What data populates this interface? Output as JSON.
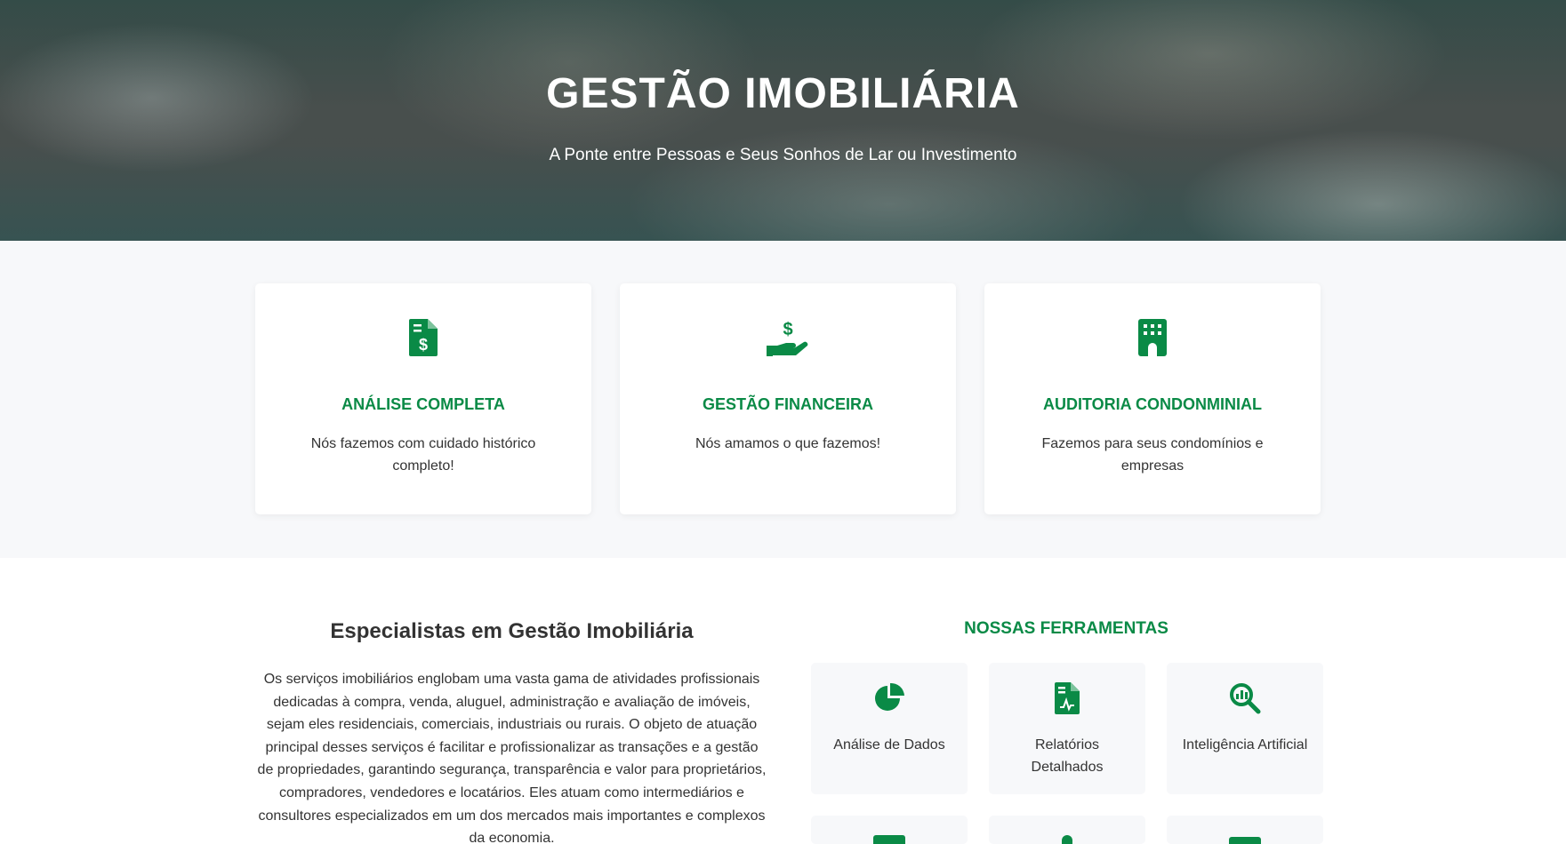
{
  "hero": {
    "title": "GESTÃO IMOBILIÁRIA",
    "subtitle": "A Ponte entre Pessoas e Seus Sonhos de Lar ou Investimento"
  },
  "features": [
    {
      "icon": "invoice-dollar-icon",
      "title": "ANÁLISE COMPLETA",
      "description": "Nós fazemos com cuidado histórico completo!"
    },
    {
      "icon": "hand-holding-dollar-icon",
      "title": "GESTÃO FINANCEIRA",
      "description": "Nós amamos o que fazemos!"
    },
    {
      "icon": "building-icon",
      "title": "AUDITORIA CONDONMINIAL",
      "description": "Fazemos para seus condomínios e empresas"
    }
  ],
  "about": {
    "title": "Especialistas em Gestão Imobiliária",
    "text": "Os serviços imobiliários englobam uma vasta gama de atividades profissionais dedicadas à compra, venda, aluguel, administração e avaliação de imóveis, sejam eles residenciais, comerciais, industriais ou rurais. O objeto de atuação principal desses serviços é facilitar e profissionalizar as transações e a gestão de propriedades, garantindo segurança, transparência e valor para proprietários, compradores, vendedores e locatários. Eles atuam como intermediários e consultores especializados em um dos mercados mais importantes e complexos da economia."
  },
  "tools": {
    "title": "NOSSAS FERRAMENTAS",
    "items": [
      {
        "icon": "pie-chart-icon",
        "label": "Análise de Dados"
      },
      {
        "icon": "file-chart-icon",
        "label": "Relatórios Detalhados"
      },
      {
        "icon": "magnifier-chart-icon",
        "label": "Inteligência Artificial"
      }
    ]
  },
  "colors": {
    "brand_green": "#0a8a46",
    "section_background": "#f7f8fa",
    "text": "#333333"
  }
}
